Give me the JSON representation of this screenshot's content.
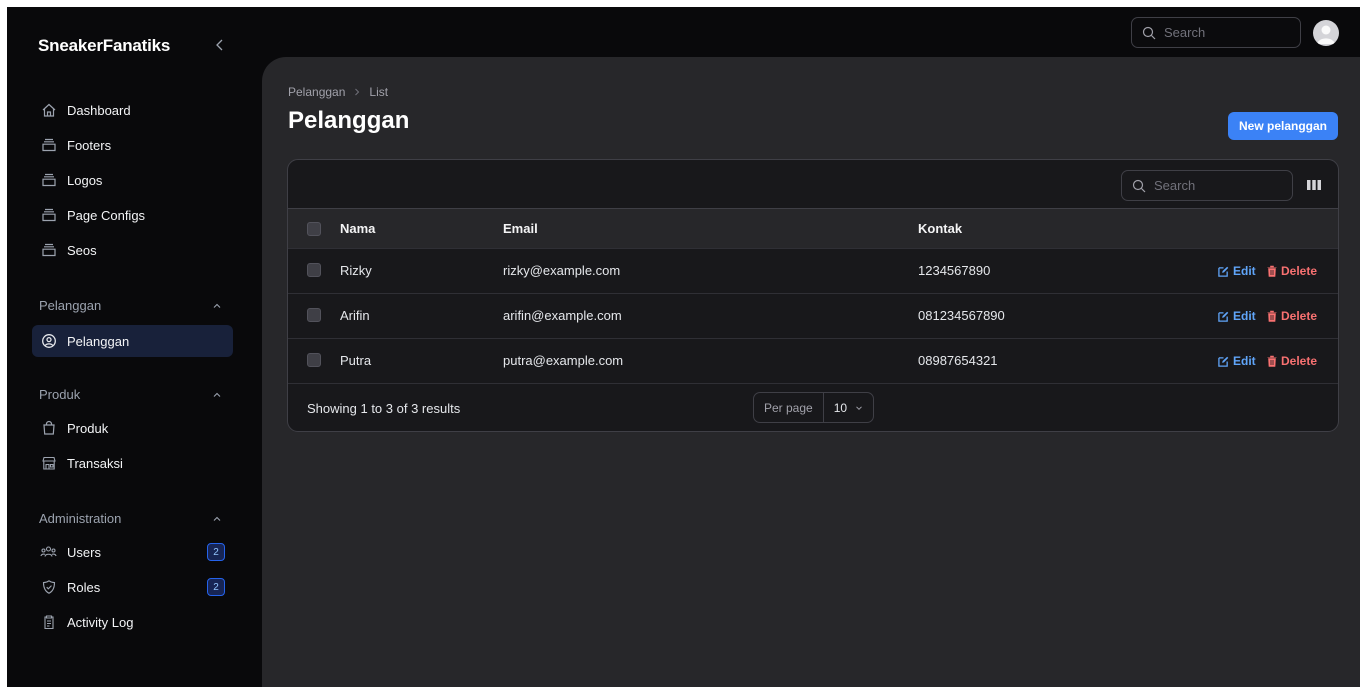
{
  "app": {
    "brand": "SneakerFanatiks"
  },
  "sidebar": {
    "top_items": [
      {
        "label": "Dashboard",
        "icon": "home-icon"
      },
      {
        "label": "Footers",
        "icon": "collection-icon"
      },
      {
        "label": "Logos",
        "icon": "collection-icon"
      },
      {
        "label": "Page Configs",
        "icon": "collection-icon"
      },
      {
        "label": "Seos",
        "icon": "collection-icon"
      }
    ],
    "groups": [
      {
        "label": "Pelanggan",
        "items": [
          {
            "label": "Pelanggan",
            "icon": "user-circle-icon",
            "active": true
          }
        ]
      },
      {
        "label": "Produk",
        "items": [
          {
            "label": "Produk",
            "icon": "shopping-bag-icon"
          },
          {
            "label": "Transaksi",
            "icon": "storefront-icon"
          }
        ]
      },
      {
        "label": "Administration",
        "items": [
          {
            "label": "Users",
            "icon": "user-group-icon",
            "badge": "2"
          },
          {
            "label": "Roles",
            "icon": "shield-check-icon",
            "badge": "2"
          },
          {
            "label": "Activity Log",
            "icon": "clipboard-icon"
          }
        ]
      }
    ]
  },
  "topbar": {
    "search_placeholder": "Search"
  },
  "header": {
    "breadcrumb": [
      "Pelanggan",
      "List"
    ],
    "title": "Pelanggan",
    "new_button": "New pelanggan"
  },
  "table": {
    "search_placeholder": "Search",
    "columns": [
      "Nama",
      "Email",
      "Kontak"
    ],
    "rows": [
      {
        "nama": "Rizky",
        "email": "rizky@example.com",
        "kontak": "1234567890"
      },
      {
        "nama": "Arifin",
        "email": "arifin@example.com",
        "kontak": "081234567890"
      },
      {
        "nama": "Putra",
        "email": "putra@example.com",
        "kontak": "08987654321"
      }
    ],
    "actions": {
      "edit": "Edit",
      "delete": "Delete"
    },
    "footer": {
      "showing": "Showing 1 to 3 of 3 results",
      "per_page_label": "Per page",
      "per_page_value": "10"
    }
  },
  "colors": {
    "accent": "#3b82f6",
    "danger": "#f87171",
    "link": "#60a5fa",
    "background": "#09090b",
    "surface": "#27272a"
  }
}
